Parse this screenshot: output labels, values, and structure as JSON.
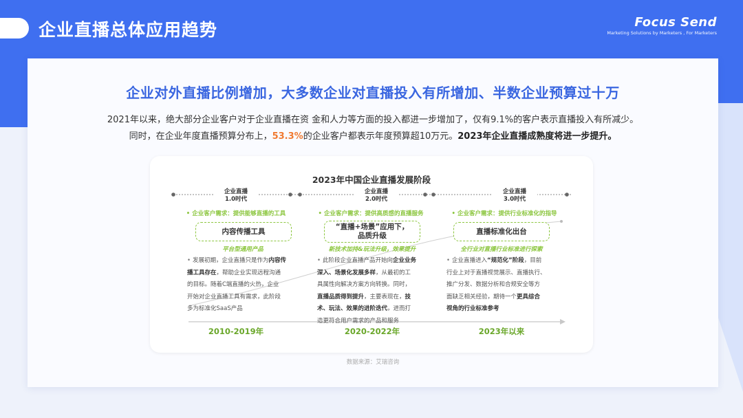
{
  "header": {
    "title": "企业直播总体应用趋势",
    "logo_text": "Focus Send",
    "logo_tagline": "Marketing Solutions by Marketers , For Marketers",
    "accent_color": "#3f6ff0"
  },
  "card": {
    "headline": "企业对外直播比例增加，大多数企业对直播投入有所增加、半数企业预算过十万",
    "para1": "2021年以来，绝大部分企业客户对于企业直播在资 金和人力等方面的投入都进一步增加了，仅有9.1%的客户表示直播投入有所减少。",
    "para2_a": "同时，在企业年度直播预算分布上，",
    "para2_highlight": "53.3%",
    "para2_b": "的企业客户都表示年度预算超10万元。",
    "para2_bold": "2023年企业直播成熟度将进一步提升。",
    "highlight_color": "#f07a30"
  },
  "panel": {
    "title": "2023年中国企业直播发展阶段",
    "source": "数据来源：艾瑞咨询",
    "accent_green": "#8cc63f",
    "stages": [
      {
        "era_line1": "企业直播",
        "era_line2": "1.0时代",
        "need": "•  企业客户需求：提供能够直播的工具",
        "box": "内容传播工具",
        "sub": "平台型通用产品",
        "d1": "发展初期，企业直播只是作为",
        "d1b": "内容传",
        "d2b": "播工具存在",
        "d2": "，帮助企业实现远程沟通",
        "d3": "的目标。随着C端直播的火热，企业",
        "d4": "开始对企业直播工具有需求，此阶段",
        "d5": "多为标准化SaaS产品",
        "year": "2010-2019年"
      },
      {
        "era_line1": "企业直播",
        "era_line2": "2.0时代",
        "need": "•  企业客户需求：提供高质感的直播服务",
        "box_line1": "“直播+场景”应用下，",
        "box_line2": "品质升级",
        "sub": "新技术加持&玩法升级，效果提升",
        "d1": "此阶段企业直播产品开始向",
        "d1b": "企业业务",
        "d2b": "深入、场景化发展多样",
        "d2": "，从最初的工",
        "d3": "具属性向解决方案方向转换。同时，",
        "d4b": "直播品质得到提升",
        "d4": "，主要表现在，",
        "d4c": "技",
        "d5b": "术、玩法、效果的进阶迭代",
        "d5": "，进而打",
        "d6": "造更符合用户需求的产品和服务",
        "year": "2020-2022年"
      },
      {
        "era_line1": "企业直播",
        "era_line2": "3.0时代",
        "need": "•  企业客户需求：提供行业标准化的指导",
        "box": "直播标准化出台",
        "sub": "全行业对直播行业标准进行探索",
        "d1": "企业直播进入",
        "d1b": "“规范化”阶段",
        "d1c": "，目前",
        "d2": "行业上对于直播视觉展示、直播执行、",
        "d3": "推广分发、数据分析和合规安全等方",
        "d4": "面缺乏相关经验，期待一个",
        "d4b": "更具综合",
        "d5b": "视角的行业标准参考",
        "year": "2023年以来"
      }
    ]
  }
}
